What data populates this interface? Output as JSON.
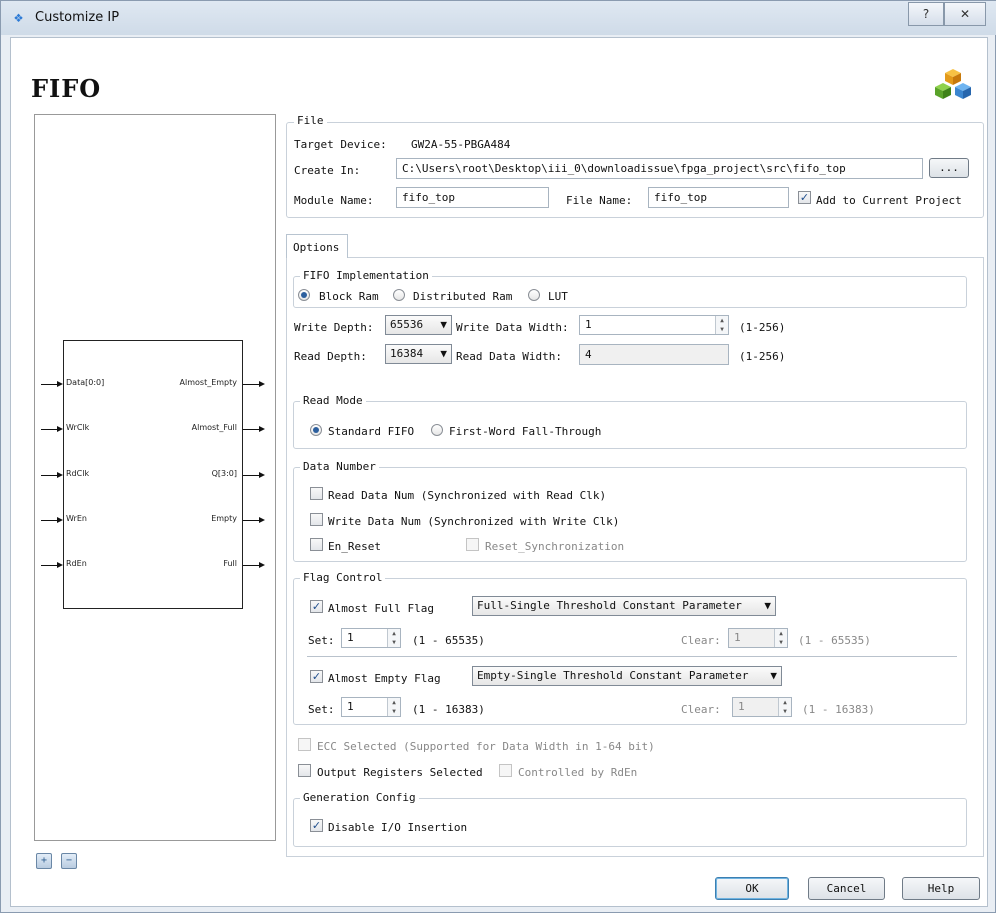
{
  "window": {
    "title": "Customize IP",
    "help_label": "?",
    "close_label": "✕"
  },
  "header": {
    "title": "FIFO"
  },
  "diagram": {
    "inputs": [
      "Data[0:0]",
      "WrClk",
      "RdClk",
      "WrEn",
      "RdEn"
    ],
    "outputs": [
      "Almost_Empty",
      "Almost_Full",
      "Q[3:0]",
      "Empty",
      "Full"
    ]
  },
  "file": {
    "group_label": "File",
    "target_device_label": "Target Device:",
    "target_device": "GW2A-55-PBGA484",
    "create_in_label": "Create In:",
    "create_in": "C:\\Users\\root\\Desktop\\iii_0\\downloadissue\\fpga_project\\src\\fifo_top",
    "browse_label": "...",
    "module_name_label": "Module Name:",
    "module_name": "fifo_top",
    "file_name_label": "File Name:",
    "file_name": "fifo_top",
    "add_to_project_label": "Add to Current Project"
  },
  "tab": {
    "label": "Options"
  },
  "impl": {
    "group_label": "FIFO Implementation",
    "options": [
      "Block Ram",
      "Distributed Ram",
      "LUT"
    ]
  },
  "depth": {
    "write_depth_label": "Write Depth:",
    "write_depth": "65536",
    "write_width_label": "Write Data Width:",
    "write_width": "1",
    "write_range": "(1-256)",
    "read_depth_label": "Read Depth:",
    "read_depth": "16384",
    "read_width_label": "Read Data Width:",
    "read_width": "4",
    "read_range": "(1-256)"
  },
  "read_mode": {
    "group_label": "Read Mode",
    "standard": "Standard FIFO",
    "fwft": "First-Word Fall-Through"
  },
  "data_number": {
    "group_label": "Data Number",
    "read_num": "Read Data Num (Synchronized with Read Clk)",
    "write_num": "Write Data Num (Synchronized with Write Clk)",
    "en_reset": "En_Reset",
    "reset_sync": "Reset_Synchronization"
  },
  "flag": {
    "group_label": "Flag Control",
    "af_label": "Almost Full Flag",
    "af_mode": "Full-Single Threshold Constant Parameter",
    "af_set_label": "Set:",
    "af_set": "1",
    "af_set_range": "(1 - 65535)",
    "af_clear_label": "Clear:",
    "af_clear": "1",
    "af_clear_range": "(1 - 65535)",
    "ae_label": "Almost Empty Flag",
    "ae_mode": "Empty-Single Threshold Constant Parameter",
    "ae_set_label": "Set:",
    "ae_set": "1",
    "ae_set_range": "(1 - 16383)",
    "ae_clear_label": "Clear:",
    "ae_clear": "1",
    "ae_clear_range": "(1 - 16383)"
  },
  "ecc": {
    "label": "ECC Selected (Supported for Data Width in 1-64 bit)"
  },
  "output_reg": {
    "label": "Output Registers Selected",
    "controlled": "Controlled by RdEn"
  },
  "gen": {
    "group_label": "Generation Config",
    "disable_io": "Disable I/O Insertion"
  },
  "buttons": {
    "ok": "OK",
    "cancel": "Cancel",
    "help": "Help"
  }
}
